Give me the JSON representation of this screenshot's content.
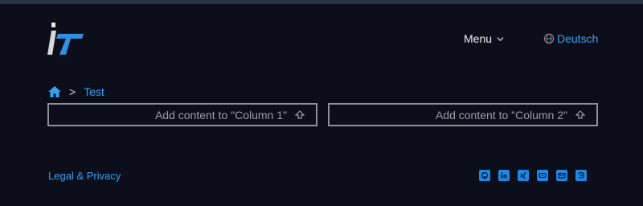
{
  "header": {
    "menu_label": "Menu",
    "language_label": "Deutsch"
  },
  "breadcrumb": {
    "current": "Test",
    "separator": ">"
  },
  "columns": [
    {
      "label": "Add content to \"Column 1\""
    },
    {
      "label": "Add content to \"Column 2\""
    }
  ],
  "footer": {
    "legal_label": "Legal & Privacy",
    "social_icons": [
      "github-icon",
      "linkedin-icon",
      "xing-icon",
      "youtube-icon",
      "email-icon",
      "mastodon-icon"
    ]
  },
  "colors": {
    "background": "#0c0f1b",
    "accent": "#3aa0f0",
    "social": "#1e88e5"
  }
}
